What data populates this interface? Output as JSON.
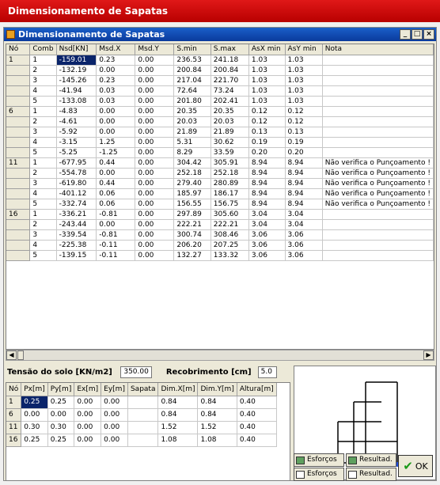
{
  "app_title": "Dimensionamento de Sapatas",
  "window_title": "Dimensionamento de Sapatas",
  "window_buttons": [
    "_",
    "□",
    "×"
  ],
  "columns": [
    "Nó",
    "Comb",
    "Nsd[KN]",
    "Msd.X",
    "Msd.Y",
    "S.min",
    "S.max",
    "AsX min",
    "AsY min",
    "Nota"
  ],
  "rows": [
    [
      "1",
      "1",
      "-159.01",
      "0.23",
      "0.00",
      "236.53",
      "241.18",
      "1.03",
      "1.03",
      ""
    ],
    [
      "",
      "2",
      "-132.19",
      "0.00",
      "0.00",
      "200.84",
      "200.84",
      "1.03",
      "1.03",
      ""
    ],
    [
      "",
      "3",
      "-145.26",
      "0.23",
      "0.00",
      "217.04",
      "221.70",
      "1.03",
      "1.03",
      ""
    ],
    [
      "",
      "4",
      "-41.94",
      "0.03",
      "0.00",
      "72.64",
      "73.24",
      "1.03",
      "1.03",
      ""
    ],
    [
      "",
      "5",
      "-133.08",
      "0.03",
      "0.00",
      "201.80",
      "202.41",
      "1.03",
      "1.03",
      ""
    ],
    [
      "6",
      "1",
      "-4.83",
      "0.00",
      "0.00",
      "20.35",
      "20.35",
      "0.12",
      "0.12",
      ""
    ],
    [
      "",
      "2",
      "-4.61",
      "0.00",
      "0.00",
      "20.03",
      "20.03",
      "0.12",
      "0.12",
      ""
    ],
    [
      "",
      "3",
      "-5.92",
      "0.00",
      "0.00",
      "21.89",
      "21.89",
      "0.13",
      "0.13",
      ""
    ],
    [
      "",
      "4",
      "-3.15",
      "1.25",
      "0.00",
      "5.31",
      "30.62",
      "0.19",
      "0.19",
      ""
    ],
    [
      "",
      "5",
      "-5.25",
      "-1.25",
      "0.00",
      "8.29",
      "33.59",
      "0.20",
      "0.20",
      ""
    ],
    [
      "11",
      "1",
      "-677.95",
      "0.44",
      "0.00",
      "304.42",
      "305.91",
      "8.94",
      "8.94",
      "Não verifica o Punçoamento !"
    ],
    [
      "",
      "2",
      "-554.78",
      "0.00",
      "0.00",
      "252.18",
      "252.18",
      "8.94",
      "8.94",
      "Não verifica o Punçoamento !"
    ],
    [
      "",
      "3",
      "-619.80",
      "0.44",
      "0.00",
      "279.40",
      "280.89",
      "8.94",
      "8.94",
      "Não verifica o Punçoamento !"
    ],
    [
      "",
      "4",
      "-401.12",
      "0.06",
      "0.00",
      "185.97",
      "186.17",
      "8.94",
      "8.94",
      "Não verifica o Punçoamento !"
    ],
    [
      "",
      "5",
      "-332.74",
      "0.06",
      "0.00",
      "156.55",
      "156.75",
      "8.94",
      "8.94",
      "Não verifica o Punçoamento !"
    ],
    [
      "16",
      "1",
      "-336.21",
      "-0.81",
      "0.00",
      "297.89",
      "305.60",
      "3.04",
      "3.04",
      ""
    ],
    [
      "",
      "2",
      "-243.44",
      "0.00",
      "0.00",
      "222.21",
      "222.21",
      "3.04",
      "3.04",
      ""
    ],
    [
      "",
      "3",
      "-339.54",
      "-0.81",
      "0.00",
      "300.74",
      "308.46",
      "3.06",
      "3.06",
      ""
    ],
    [
      "",
      "4",
      "-225.38",
      "-0.11",
      "0.00",
      "206.20",
      "207.25",
      "3.06",
      "3.06",
      ""
    ],
    [
      "",
      "5",
      "-139.15",
      "-0.11",
      "0.00",
      "132.27",
      "133.32",
      "3.06",
      "3.06",
      ""
    ]
  ],
  "soil_label": "Tensão do solo [KN/m2]",
  "soil_value": "350.00",
  "cover_label": "Recobrimento [cm]",
  "cover_value": "5.0",
  "footing_columns": [
    "Nó",
    "Px[m]",
    "Py[m]",
    "Ex[m]",
    "Ey[m]",
    "Sapata",
    "Dim.X[m]",
    "Dim.Y[m]",
    "Altura[m]"
  ],
  "footing_rows": [
    [
      "1",
      "0.25",
      "0.25",
      "0.00",
      "0.00",
      "",
      "0.84",
      "0.84",
      "0.40"
    ],
    [
      "6",
      "0.00",
      "0.00",
      "0.00",
      "0.00",
      "",
      "0.84",
      "0.84",
      "0.40"
    ],
    [
      "11",
      "0.30",
      "0.30",
      "0.00",
      "0.00",
      "",
      "1.52",
      "1.52",
      "0.40"
    ],
    [
      "16",
      "0.25",
      "0.25",
      "0.00",
      "0.00",
      "",
      "1.08",
      "1.08",
      "0.40"
    ]
  ],
  "buttons": {
    "esforcos_1": "Esforços",
    "resultados_1": "Resultad.",
    "esforcos_2": "Esforços",
    "resultados_2": "Resultad.",
    "ok": "OK"
  },
  "colors": {
    "title_red": "#d00000",
    "selection": "#0a246a",
    "support_blue": "#2050e0",
    "support_red": "#e02020"
  }
}
